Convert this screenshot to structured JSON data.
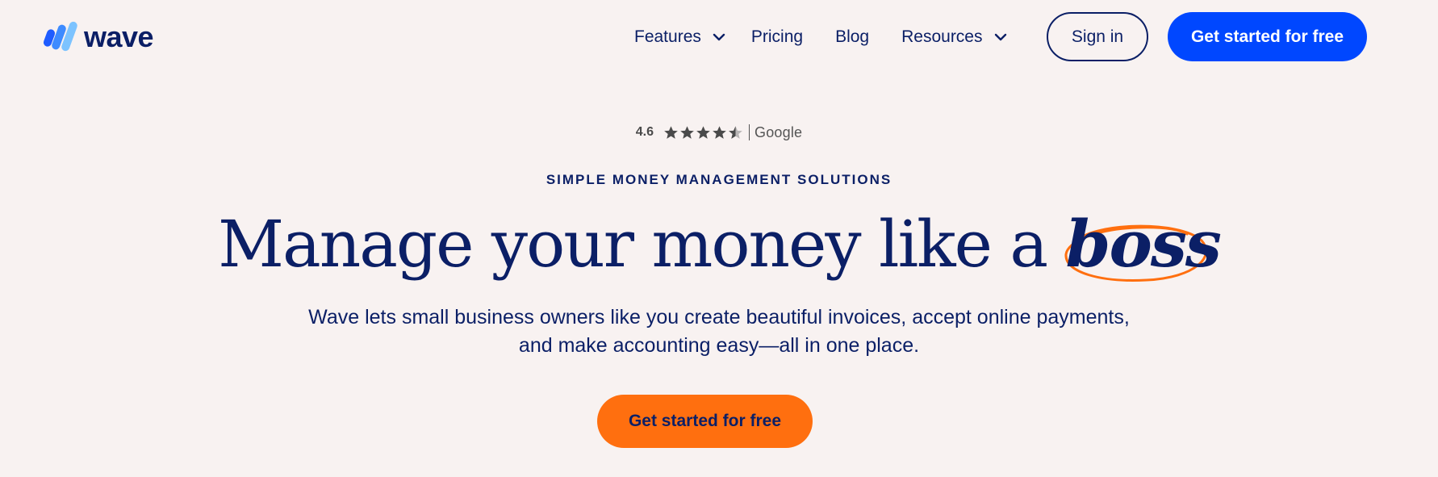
{
  "brand": {
    "name": "wave",
    "logo_icon": "wave-logo-mark",
    "primary_color": "#0047ff",
    "accent_color": "#ff6f0f",
    "text_color": "#0b1f66"
  },
  "nav": {
    "items": [
      {
        "label": "Features",
        "has_dropdown": true
      },
      {
        "label": "Pricing",
        "has_dropdown": false
      },
      {
        "label": "Blog",
        "has_dropdown": false
      },
      {
        "label": "Resources",
        "has_dropdown": true
      }
    ],
    "signin_label": "Sign in",
    "primary_cta_label": "Get started for free"
  },
  "rating": {
    "score": "4.6",
    "stars": 4.5,
    "stars_max": 5,
    "source": "Google"
  },
  "hero": {
    "eyebrow": "SIMPLE MONEY MANAGEMENT SOLUTIONS",
    "headline_lead": "Manage your money like a ",
    "headline_emphasis": "boss",
    "subtext_line1": "Wave lets small business owners like you create beautiful invoices, accept online payments,",
    "subtext_line2": "and make accounting easy—all in one place.",
    "cta_label": "Get started for free"
  }
}
